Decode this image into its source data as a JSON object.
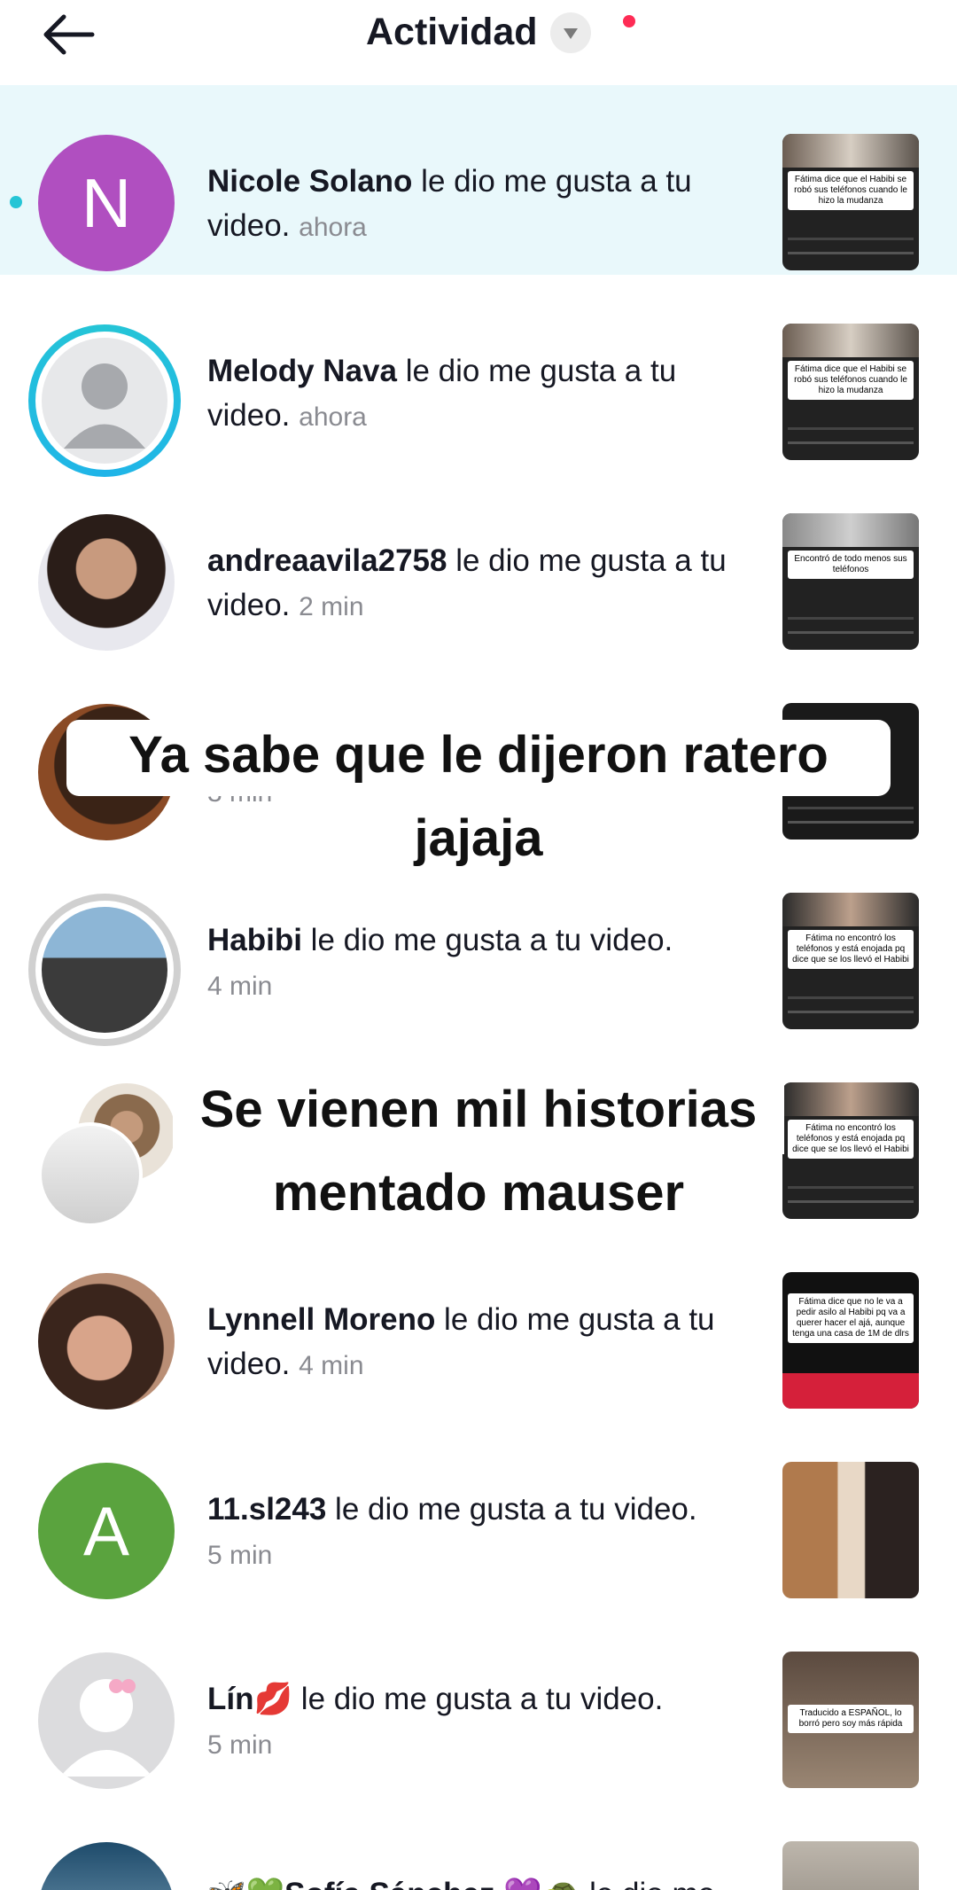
{
  "header": {
    "title": "Actividad"
  },
  "captions": {
    "line1": "Ya sabe que le dijeron ratero",
    "line2": "jajaja",
    "line3": "Se vienen mil historias",
    "line4": "mentado mauser"
  },
  "notifications": [
    {
      "user": "Nicole Solano",
      "action": " le dio me gusta a tu video.",
      "time": "ahora",
      "avatar_letter": "N",
      "avatar_color": "#b04fc0",
      "unread": true,
      "thumb_caption": "Fátima dice que el Habibi se robó sus teléfonos cuando le hizo la mudanza"
    },
    {
      "user": "Melody Nava",
      "action": " le dio me gusta a tu video.",
      "time": "ahora",
      "thumb_caption": "Fátima dice que el Habibi se robó sus teléfonos cuando le hizo la mudanza"
    },
    {
      "user": "andreaavila2758",
      "action": " le dio me gusta a tu video.",
      "time": "2 min",
      "thumb_caption": "Encontró de todo menos sus teléfonos"
    },
    {
      "user": "",
      "action": "",
      "time": "3 min",
      "thumb_caption": ""
    },
    {
      "user": "Habibi",
      "action": " le dio me gusta a tu video.",
      "time": "4 min",
      "thumb_caption": "Fátima no encontró los teléfonos y está enojada pq dice que se los llevó el Habibi"
    },
    {
      "user": "",
      "action": "",
      "time": "",
      "thumb_caption": "Fátima no encontró los teléfonos y está enojada pq dice que se los llevó el Habibi"
    },
    {
      "user": "Lynnell Moreno",
      "action": " le dio me gusta a tu video.",
      "time": "4 min",
      "thumb_caption": "Fátima dice que no le va a pedir asilo al Habibi pq va a querer hacer el ajá, aunque tenga una casa de 1M de dlrs"
    },
    {
      "user": "11.sl243",
      "action": " le dio me gusta a tu video.",
      "time": "5 min",
      "avatar_letter": "A",
      "avatar_color": "#5aa33e",
      "thumb_caption": ""
    },
    {
      "user": "Lín💋",
      "action": " le dio me gusta a tu video.",
      "time": "5 min",
      "thumb_caption": "Traducido a ESPAÑOL, lo borró pero soy más rápida"
    },
    {
      "user": "🦋💚Sofía Sánchez 💜🐢",
      "action": " le dio me",
      "time": "",
      "thumb_caption": ""
    }
  ]
}
